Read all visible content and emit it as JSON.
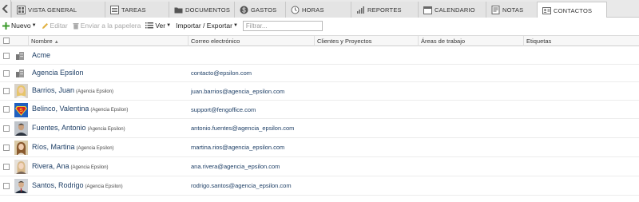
{
  "tabs": [
    {
      "label": "VISTA GENERAL",
      "icon": "overview-icon"
    },
    {
      "label": "TAREAS",
      "icon": "tasks-icon"
    },
    {
      "label": "DOCUMENTOS",
      "icon": "documents-icon"
    },
    {
      "label": "GASTOS",
      "icon": "expenses-icon"
    },
    {
      "label": "HORAS",
      "icon": "hours-icon"
    },
    {
      "label": "REPORTES",
      "icon": "reports-icon"
    },
    {
      "label": "CALENDARIO",
      "icon": "calendar-icon"
    },
    {
      "label": "NOTAS",
      "icon": "notes-icon"
    },
    {
      "label": "CONTACTOS",
      "icon": "contacts-icon",
      "active": true
    }
  ],
  "toolbar": {
    "new_label": "Nuevo",
    "edit_label": "Editar",
    "trash_label": "Enviar a la papelera",
    "view_label": "Ver",
    "import_export_label": "Importar / Exportar",
    "filter_placeholder": "Filtrar..."
  },
  "grid": {
    "columns": {
      "name": "Nombre",
      "email": "Correo electrónico",
      "clients": "Clientes y Proyectos",
      "workspaces": "Áreas de trabajo",
      "tags": "Etiquetas"
    },
    "rows": [
      {
        "type": "company",
        "name": "Acme",
        "company": "",
        "email": ""
      },
      {
        "type": "company",
        "name": "Agencia Epsilon",
        "company": "",
        "email": "contacto@epsilon.com"
      },
      {
        "type": "person",
        "name": "Barrios, Juan",
        "company": "(Agencia Epsilon)",
        "email": "juan.barrios@agencia_epsilon.com",
        "avatar": "avatar-woman-blonde"
      },
      {
        "type": "person",
        "name": "Belinco, Valentina",
        "company": "(Agencia Epsilon)",
        "email": "support@fengoffice.com",
        "avatar": "avatar-superman-logo"
      },
      {
        "type": "person",
        "name": "Fuentes, Antonio",
        "company": "(Agencia Epsilon)",
        "email": "antonio.fuentes@agencia_epsilon.com",
        "avatar": "avatar-man-dark"
      },
      {
        "type": "person",
        "name": "Ríos, Martina",
        "company": "(Agencia Epsilon)",
        "email": "martina.rios@agencia_epsilon.com",
        "avatar": "avatar-woman-brunette"
      },
      {
        "type": "person",
        "name": "Rivera, Ana",
        "company": "(Agencia Epsilon)",
        "email": "ana.rivera@agencia_epsilon.com",
        "avatar": "avatar-woman-light"
      },
      {
        "type": "person",
        "name": "Santos, Rodrigo",
        "company": "(Agencia Epsilon)",
        "email": "rodrigo.santos@agencia_epsilon.com",
        "avatar": "avatar-man-suit"
      }
    ]
  }
}
